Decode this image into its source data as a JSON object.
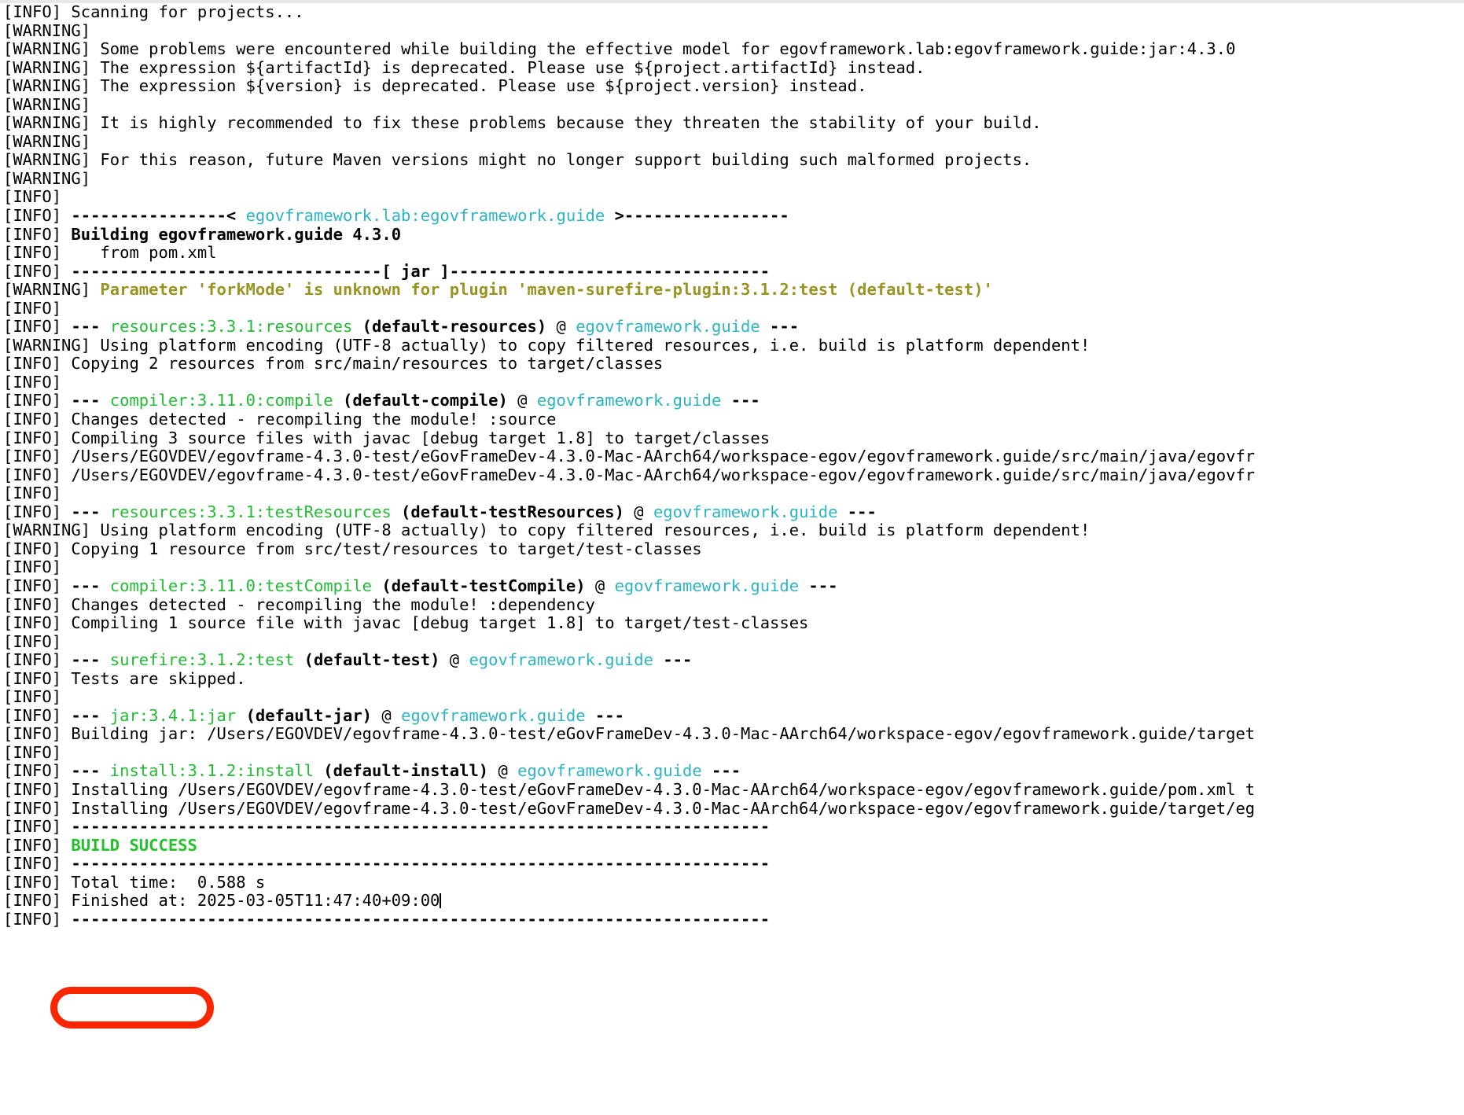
{
  "terminal": {
    "title": "maven-build-output",
    "colors": {
      "background": "#ffffff",
      "foreground": "#000000",
      "cyan": "#2cb5c0",
      "green": "#22bb33",
      "yellow": "#9a9422",
      "success_green": "#22c32a",
      "annotation_red": "#fa2600"
    },
    "annotation": {
      "shape": "rounded-rectangle",
      "target_text": "BUILD SUCCESS",
      "color": "#fa2600"
    }
  },
  "log": {
    "lines": [
      {
        "id": 0,
        "prefix": "[INFO] ",
        "text": "Scanning for projects..."
      },
      {
        "id": 1,
        "prefix": "[WARNING] ",
        "text": ""
      },
      {
        "id": 2,
        "prefix": "[WARNING] ",
        "text": "Some problems were encountered while building the effective model for egovframework.lab:egovframework.guide:jar:4.3.0"
      },
      {
        "id": 3,
        "prefix": "[WARNING] ",
        "text": "The expression ${artifactId} is deprecated. Please use ${project.artifactId} instead."
      },
      {
        "id": 4,
        "prefix": "[WARNING] ",
        "text": "The expression ${version} is deprecated. Please use ${project.version} instead."
      },
      {
        "id": 5,
        "prefix": "[WARNING] ",
        "text": ""
      },
      {
        "id": 6,
        "prefix": "[WARNING] ",
        "text": "It is highly recommended to fix these problems because they threaten the stability of your build."
      },
      {
        "id": 7,
        "prefix": "[WARNING] ",
        "text": ""
      },
      {
        "id": 8,
        "prefix": "[WARNING] ",
        "text": "For this reason, future Maven versions might no longer support building such malformed projects."
      },
      {
        "id": 9,
        "prefix": "[WARNING] ",
        "text": ""
      },
      {
        "id": 10,
        "prefix": "[INFO] ",
        "text": ""
      },
      {
        "id": 11,
        "prefix": "[INFO] ",
        "segments": [
          {
            "text": "----------------< ",
            "style": "b"
          },
          {
            "text": "egovframework.lab:egovframework.guide",
            "style": "c-cyan"
          },
          {
            "text": " >-----------------",
            "style": "b"
          }
        ]
      },
      {
        "id": 12,
        "prefix": "[INFO] ",
        "segments": [
          {
            "text": "Building egovframework.guide 4.3.0",
            "style": "b"
          }
        ]
      },
      {
        "id": 13,
        "prefix": "[INFO] ",
        "text": "   from pom.xml"
      },
      {
        "id": 14,
        "prefix": "[INFO] ",
        "segments": [
          {
            "text": "--------------------------------[ jar ]---------------------------------",
            "style": "b"
          }
        ]
      },
      {
        "id": 15,
        "prefix": "[WARNING] ",
        "segments": [
          {
            "text": "Parameter 'forkMode' is unknown for plugin 'maven-surefire-plugin:3.1.2:test (default-test)'",
            "style": "c-yellow"
          }
        ]
      },
      {
        "id": 16,
        "prefix": "[INFO] ",
        "text": ""
      },
      {
        "id": 17,
        "prefix": "[INFO] ",
        "segments": [
          {
            "text": "--- ",
            "style": "b"
          },
          {
            "text": "resources:3.3.1:resources",
            "style": "c-green"
          },
          {
            "text": " (default-resources)",
            "style": "b"
          },
          {
            "text": " @ ",
            "style": "c-default"
          },
          {
            "text": "egovframework.guide",
            "style": "c-cyan"
          },
          {
            "text": " ---",
            "style": "b"
          }
        ]
      },
      {
        "id": 18,
        "prefix": "[WARNING] ",
        "text": "Using platform encoding (UTF-8 actually) to copy filtered resources, i.e. build is platform dependent!"
      },
      {
        "id": 19,
        "prefix": "[INFO] ",
        "text": "Copying 2 resources from src/main/resources to target/classes"
      },
      {
        "id": 20,
        "prefix": "[INFO] ",
        "text": ""
      },
      {
        "id": 21,
        "prefix": "[INFO] ",
        "segments": [
          {
            "text": "--- ",
            "style": "b"
          },
          {
            "text": "compiler:3.11.0:compile",
            "style": "c-green"
          },
          {
            "text": " (default-compile)",
            "style": "b"
          },
          {
            "text": " @ ",
            "style": "c-default"
          },
          {
            "text": "egovframework.guide",
            "style": "c-cyan"
          },
          {
            "text": " ---",
            "style": "b"
          }
        ]
      },
      {
        "id": 22,
        "prefix": "[INFO] ",
        "text": "Changes detected - recompiling the module! :source"
      },
      {
        "id": 23,
        "prefix": "[INFO] ",
        "text": "Compiling 3 source files with javac [debug target 1.8] to target/classes"
      },
      {
        "id": 24,
        "prefix": "[INFO] ",
        "text": "/Users/EGOVDEV/egovframe-4.3.0-test/eGovFrameDev-4.3.0-Mac-AArch64/workspace-egov/egovframework.guide/src/main/java/egovfr"
      },
      {
        "id": 25,
        "prefix": "[INFO] ",
        "text": "/Users/EGOVDEV/egovframe-4.3.0-test/eGovFrameDev-4.3.0-Mac-AArch64/workspace-egov/egovframework.guide/src/main/java/egovfr"
      },
      {
        "id": 26,
        "prefix": "[INFO] ",
        "text": ""
      },
      {
        "id": 27,
        "prefix": "[INFO] ",
        "segments": [
          {
            "text": "--- ",
            "style": "b"
          },
          {
            "text": "resources:3.3.1:testResources",
            "style": "c-green"
          },
          {
            "text": " (default-testResources)",
            "style": "b"
          },
          {
            "text": " @ ",
            "style": "c-default"
          },
          {
            "text": "egovframework.guide",
            "style": "c-cyan"
          },
          {
            "text": " ---",
            "style": "b"
          }
        ]
      },
      {
        "id": 28,
        "prefix": "[WARNING] ",
        "text": "Using platform encoding (UTF-8 actually) to copy filtered resources, i.e. build is platform dependent!"
      },
      {
        "id": 29,
        "prefix": "[INFO] ",
        "text": "Copying 1 resource from src/test/resources to target/test-classes"
      },
      {
        "id": 30,
        "prefix": "[INFO] ",
        "text": ""
      },
      {
        "id": 31,
        "prefix": "[INFO] ",
        "segments": [
          {
            "text": "--- ",
            "style": "b"
          },
          {
            "text": "compiler:3.11.0:testCompile",
            "style": "c-green"
          },
          {
            "text": " (default-testCompile)",
            "style": "b"
          },
          {
            "text": " @ ",
            "style": "c-default"
          },
          {
            "text": "egovframework.guide",
            "style": "c-cyan"
          },
          {
            "text": " ---",
            "style": "b"
          }
        ]
      },
      {
        "id": 32,
        "prefix": "[INFO] ",
        "text": "Changes detected - recompiling the module! :dependency"
      },
      {
        "id": 33,
        "prefix": "[INFO] ",
        "text": "Compiling 1 source file with javac [debug target 1.8] to target/test-classes"
      },
      {
        "id": 34,
        "prefix": "[INFO] ",
        "text": ""
      },
      {
        "id": 35,
        "prefix": "[INFO] ",
        "segments": [
          {
            "text": "--- ",
            "style": "b"
          },
          {
            "text": "surefire:3.1.2:test",
            "style": "c-green"
          },
          {
            "text": " (default-test)",
            "style": "b"
          },
          {
            "text": " @ ",
            "style": "c-default"
          },
          {
            "text": "egovframework.guide",
            "style": "c-cyan"
          },
          {
            "text": " ---",
            "style": "b"
          }
        ]
      },
      {
        "id": 36,
        "prefix": "[INFO] ",
        "text": "Tests are skipped."
      },
      {
        "id": 37,
        "prefix": "[INFO] ",
        "text": ""
      },
      {
        "id": 38,
        "prefix": "[INFO] ",
        "segments": [
          {
            "text": "--- ",
            "style": "b"
          },
          {
            "text": "jar:3.4.1:jar",
            "style": "c-green"
          },
          {
            "text": " (default-jar)",
            "style": "b"
          },
          {
            "text": " @ ",
            "style": "c-default"
          },
          {
            "text": "egovframework.guide",
            "style": "c-cyan"
          },
          {
            "text": " ---",
            "style": "b"
          }
        ]
      },
      {
        "id": 39,
        "prefix": "[INFO] ",
        "text": "Building jar: /Users/EGOVDEV/egovframe-4.3.0-test/eGovFrameDev-4.3.0-Mac-AArch64/workspace-egov/egovframework.guide/target"
      },
      {
        "id": 40,
        "prefix": "[INFO] ",
        "text": ""
      },
      {
        "id": 41,
        "prefix": "[INFO] ",
        "segments": [
          {
            "text": "--- ",
            "style": "b"
          },
          {
            "text": "install:3.1.2:install",
            "style": "c-green"
          },
          {
            "text": " (default-install)",
            "style": "b"
          },
          {
            "text": " @ ",
            "style": "c-default"
          },
          {
            "text": "egovframework.guide",
            "style": "c-cyan"
          },
          {
            "text": " ---",
            "style": "b"
          }
        ]
      },
      {
        "id": 42,
        "prefix": "[INFO] ",
        "text": "Installing /Users/EGOVDEV/egovframe-4.3.0-test/eGovFrameDev-4.3.0-Mac-AArch64/workspace-egov/egovframework.guide/pom.xml t"
      },
      {
        "id": 43,
        "prefix": "[INFO] ",
        "text": "Installing /Users/EGOVDEV/egovframe-4.3.0-test/eGovFrameDev-4.3.0-Mac-AArch64/workspace-egov/egovframework.guide/target/eg"
      },
      {
        "id": 44,
        "prefix": "[INFO] ",
        "segments": [
          {
            "text": "------------------------------------------------------------------------",
            "style": "b"
          }
        ]
      },
      {
        "id": 45,
        "prefix": "[INFO] ",
        "segments": [
          {
            "text": "BUILD SUCCESS",
            "style": "c-success"
          }
        ]
      },
      {
        "id": 46,
        "prefix": "[INFO] ",
        "segments": [
          {
            "text": "------------------------------------------------------------------------",
            "style": "b"
          }
        ]
      },
      {
        "id": 47,
        "prefix": "[INFO] ",
        "text": "Total time:  0.588 s"
      },
      {
        "id": 48,
        "prefix": "[INFO] ",
        "text": "Finished at: 2025-03-05T11:47:40+09:00",
        "caret": true
      },
      {
        "id": 49,
        "prefix": "[INFO] ",
        "segments": [
          {
            "text": "------------------------------------------------------------------------",
            "style": "b"
          }
        ]
      }
    ]
  }
}
